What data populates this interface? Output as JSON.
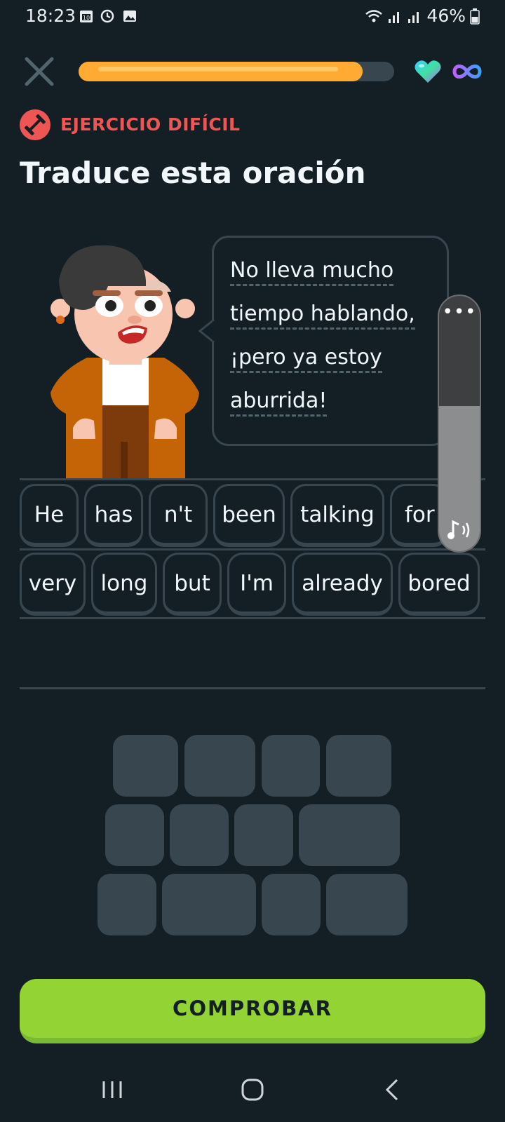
{
  "status_bar": {
    "time": "18:23",
    "battery": "46%",
    "icons": [
      "calendar-icon",
      "sync-icon",
      "image-icon",
      "wifi-icon",
      "signal-icon",
      "signal-icon",
      "battery-icon"
    ]
  },
  "top_bar": {
    "close_icon": "close-icon",
    "progress_fraction": 0.9,
    "hearts_icon": "heart-icon",
    "hearts_value": "infinity"
  },
  "header": {
    "badge": "EJERCICIO DIFÍCIL",
    "title": "Traduce esta oración"
  },
  "prompt": {
    "lines": [
      "No lleva mucho",
      "tiempo hablando,",
      "¡pero ya estoy",
      "aburrida!"
    ]
  },
  "volume": {
    "menu_glyph": "•••",
    "level_fraction": 0.57
  },
  "answer": {
    "row1": [
      "He",
      "has",
      "n't",
      "been",
      "talking",
      "for"
    ],
    "row2": [
      "very",
      "long",
      "but",
      "I'm",
      "already",
      "bored"
    ]
  },
  "actions": {
    "check_label": "COMPROBAR"
  },
  "colors": {
    "background": "#131f24",
    "accent_red": "#ee5555",
    "progress": "#ffab33",
    "check_green": "#93d333",
    "chip_border": "#37464f"
  }
}
